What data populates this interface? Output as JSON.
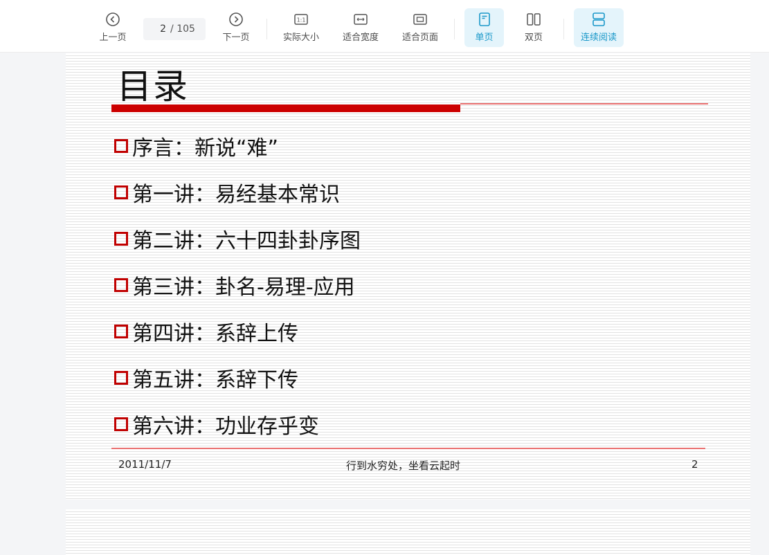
{
  "toolbar": {
    "prev_label": "上一页",
    "page_current": "2",
    "page_total": "/ 105",
    "next_label": "下一页",
    "actual_size_label": "实际大小",
    "actual_size_icon_text": "1:1",
    "fit_width_label": "适合宽度",
    "fit_page_label": "适合页面",
    "single_page_label": "单页",
    "double_page_label": "双页",
    "continuous_label": "连续阅读",
    "accent_color": "#1a98c9",
    "active_bg": "#e4f4fb"
  },
  "slide": {
    "title": "目录",
    "items": [
      "序言：新说“难”",
      "第一讲：易经基本常识",
      "第二讲：六十四卦卦序图",
      "第三讲：卦名-易理-应用",
      "第四讲：系辞上传",
      "第五讲：系辞下传",
      "第六讲：功业存乎变"
    ],
    "footer": {
      "date": "2011/11/7",
      "motto": "行到水穷处，坐看云起时",
      "page_number": "2"
    },
    "accent_color": "#cc0000"
  }
}
